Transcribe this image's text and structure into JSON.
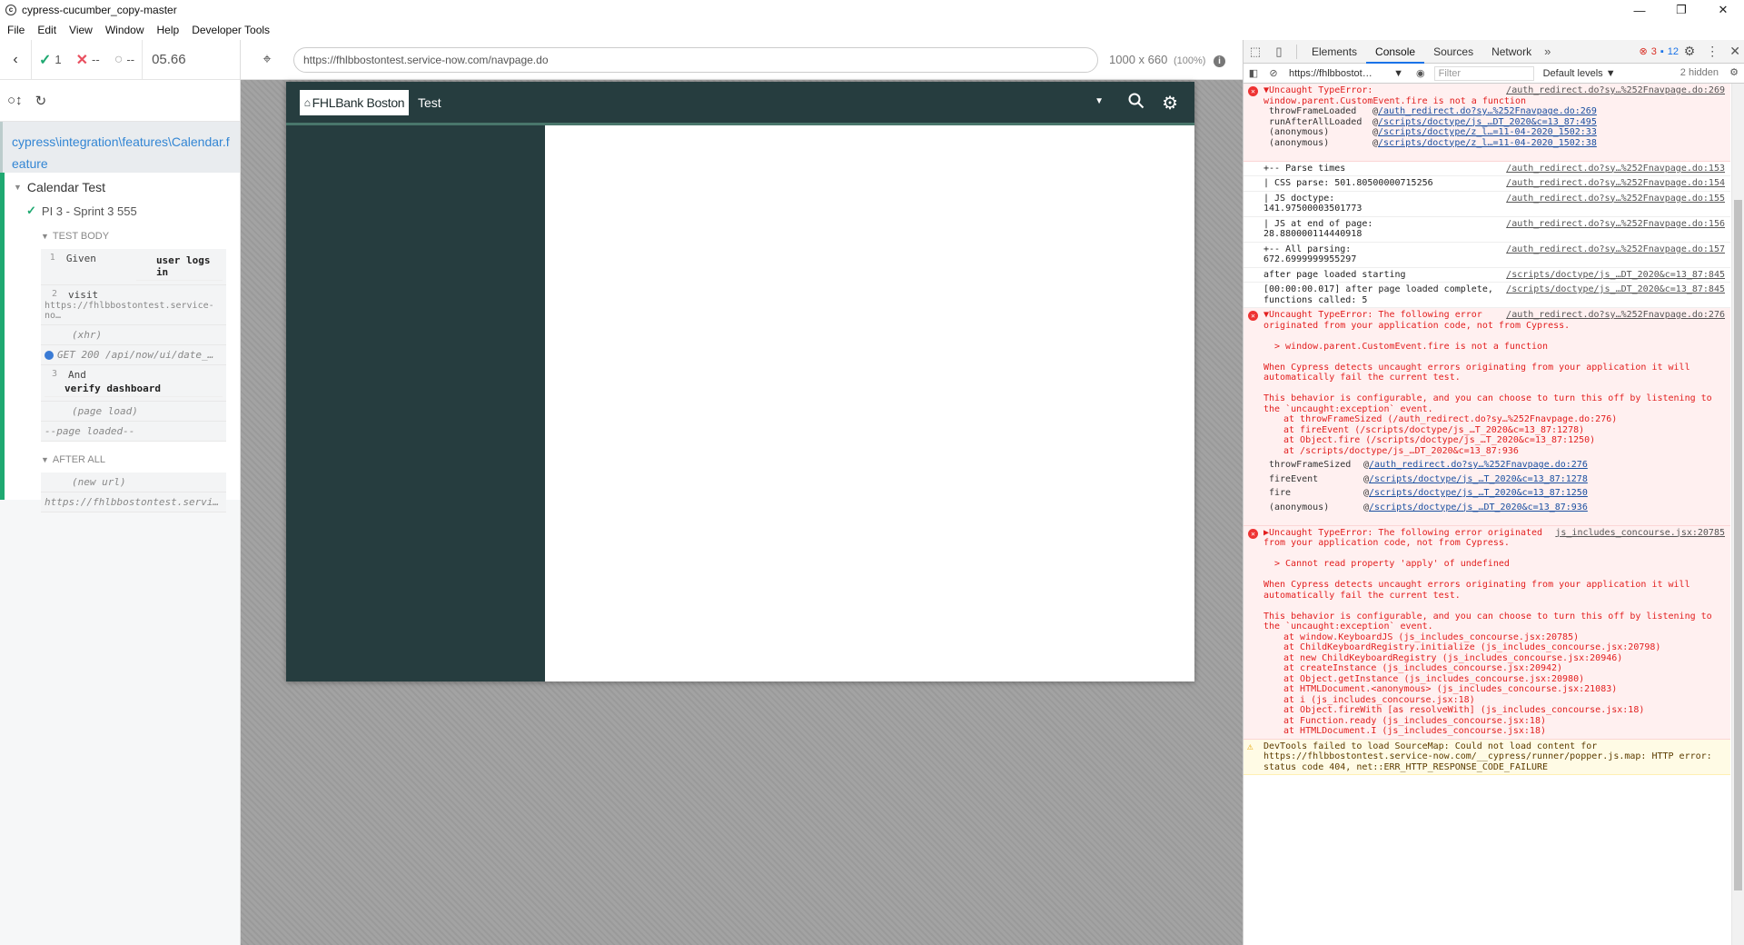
{
  "window": {
    "title": "cypress-cucumber_copy-master",
    "controls": [
      "—",
      "❐",
      "✕"
    ]
  },
  "menu": [
    "File",
    "Edit",
    "View",
    "Window",
    "Help",
    "Developer Tools"
  ],
  "reporter": {
    "passed": "1",
    "failed": "--",
    "pending": "--",
    "duration": "05.66",
    "spec_file": "cypress\\integration\\features\\Calendar.feature",
    "suite": "Calendar Test",
    "test": "PI 3 - Sprint 3 555",
    "test_body_label": "TEST BODY",
    "after_all_label": "AFTER ALL",
    "commands": [
      {
        "num": "1",
        "name": "Given",
        "message": "user logs in"
      },
      {
        "num": "2",
        "name": "visit",
        "message": "https://fhlbbostontest.service-no…"
      },
      {
        "sub": "(xhr)"
      },
      {
        "xhr": "GET 200 /api/now/ui/date_…"
      },
      {
        "num": "3",
        "name": "And",
        "message": "verify dashboard"
      },
      {
        "sub": "(page load)"
      },
      {
        "sub": "--page loaded--"
      }
    ],
    "after_all": [
      {
        "sub": "(new url)"
      },
      {
        "sub": "https://fhlbbostontest.servi…"
      }
    ]
  },
  "aut": {
    "url": "https://fhlbbostontest.service-now.com/navpage.do",
    "viewport": "1000 x 660",
    "zoom": "(100%)",
    "app_logo": "FHLBank Boston",
    "app_title": "Test"
  },
  "devtools": {
    "tabs": [
      "Elements",
      "Console",
      "Sources",
      "Network"
    ],
    "active_tab": "Console",
    "error_count": "3",
    "message_count": "12",
    "context": "https://fhlbbostot…",
    "filter_placeholder": "Filter",
    "levels": "Default levels",
    "hidden": "2 hidden",
    "console": {
      "err1": {
        "title": "▼Uncaught TypeError:",
        "line2": "window.parent.CustomEvent.fire is not a function",
        "src": "/auth_redirect.do?sy…%252Fnavpage.do:269",
        "stack": [
          {
            "fn": "throwFrameLoaded",
            "loc": "/auth_redirect.do?sy…%252Fnavpage.do:269"
          },
          {
            "fn": "runAfterAllLoaded",
            "loc": "/scripts/doctype/js_…DT_2020&c=13_87:495"
          },
          {
            "fn": "(anonymous)",
            "loc": "/scripts/doctype/z_l…=11-04-2020_1502:33"
          },
          {
            "fn": "(anonymous)",
            "loc": "/scripts/doctype/z_l…=11-04-2020_1502:38"
          }
        ]
      },
      "logs": [
        {
          "text": "+-- Parse times",
          "src": "/auth_redirect.do?sy…%252Fnavpage.do:153"
        },
        {
          "text": "| CSS parse: 501.80500000715256",
          "src": "/auth_redirect.do?sy…%252Fnavpage.do:154"
        },
        {
          "text": "| JS  doctype: 141.97500003501773",
          "src": "/auth_redirect.do?sy…%252Fnavpage.do:155"
        },
        {
          "text": "| JS at end of page: 28.880000114440918",
          "src": "/auth_redirect.do?sy…%252Fnavpage.do:156"
        },
        {
          "text": "+-- All parsing: 672.6999999955297",
          "src": "/auth_redirect.do?sy…%252Fnavpage.do:157"
        },
        {
          "text": "after page loaded starting",
          "src": "/scripts/doctype/js_…DT_2020&c=13_87:845"
        },
        {
          "text": "[00:00:00.017] after page loaded complete, functions called: 5",
          "src": "/scripts/doctype/js_…DT_2020&c=13_87:845"
        }
      ],
      "err2": {
        "title": "▼Uncaught TypeError: The following error originated from your application code, not from Cypress.",
        "src": "/auth_redirect.do?sy…%252Fnavpage.do:276",
        "quote": "> window.parent.CustomEvent.fire is not a function",
        "p1": "When Cypress detects uncaught errors originating from your application it will automatically fail the current test.",
        "p2": "This behavior is configurable, and you can choose to turn this off by listening to the `uncaught:exception` event.",
        "at": [
          "at throwFrameSized (/auth_redirect.do?sy…%252Fnavpage.do:276)",
          "at fireEvent (/scripts/doctype/js_…T_2020&c=13_87:1278)",
          "at Object.fire (/scripts/doctype/js_…T_2020&c=13_87:1250)",
          "at /scripts/doctype/js_…DT_2020&c=13_87:936"
        ],
        "stack": [
          {
            "fn": "throwFrameSized",
            "loc": "/auth_redirect.do?sy…%252Fnavpage.do:276"
          },
          {
            "fn": "fireEvent",
            "loc": "/scripts/doctype/js_…T_2020&c=13_87:1278"
          },
          {
            "fn": "fire",
            "loc": "/scripts/doctype/js_…T_2020&c=13_87:1250"
          },
          {
            "fn": "(anonymous)",
            "loc": "/scripts/doctype/js_…DT_2020&c=13_87:936"
          }
        ]
      },
      "err3": {
        "title": "▶Uncaught TypeError: The following error originated from your application code, not from Cypress.",
        "src": "js_includes_concourse.jsx:20785",
        "quote": "> Cannot read property 'apply' of undefined",
        "p1": "When Cypress detects uncaught errors originating from your application it will automatically fail the current test.",
        "p2": "This behavior is configurable, and you can choose to turn this off by listening to the `uncaught:exception` event.",
        "at": [
          "at window.KeyboardJS (js_includes_concourse.jsx:20785)",
          "at ChildKeyboardRegistry.initialize (js_includes_concourse.jsx:20798)",
          "at new ChildKeyboardRegistry (js_includes_concourse.jsx:20946)",
          "at createInstance (js_includes_concourse.jsx:20942)",
          "at Object.getInstance (js_includes_concourse.jsx:20980)",
          "at HTMLDocument.<anonymous> (js_includes_concourse.jsx:21083)",
          "at i (js_includes_concourse.jsx:18)",
          "at Object.fireWith [as resolveWith] (js_includes_concourse.jsx:18)",
          "at Function.ready (js_includes_concourse.jsx:18)",
          "at HTMLDocument.I (js_includes_concourse.jsx:18)"
        ]
      },
      "warn": {
        "text": "DevTools failed to load SourceMap: Could not load content for https://fhlbbostontest.service-now.com/__cypress/runner/popper.js.map: HTTP error: status code 404, net::ERR_HTTP_RESPONSE_CODE_FAILURE"
      }
    }
  }
}
